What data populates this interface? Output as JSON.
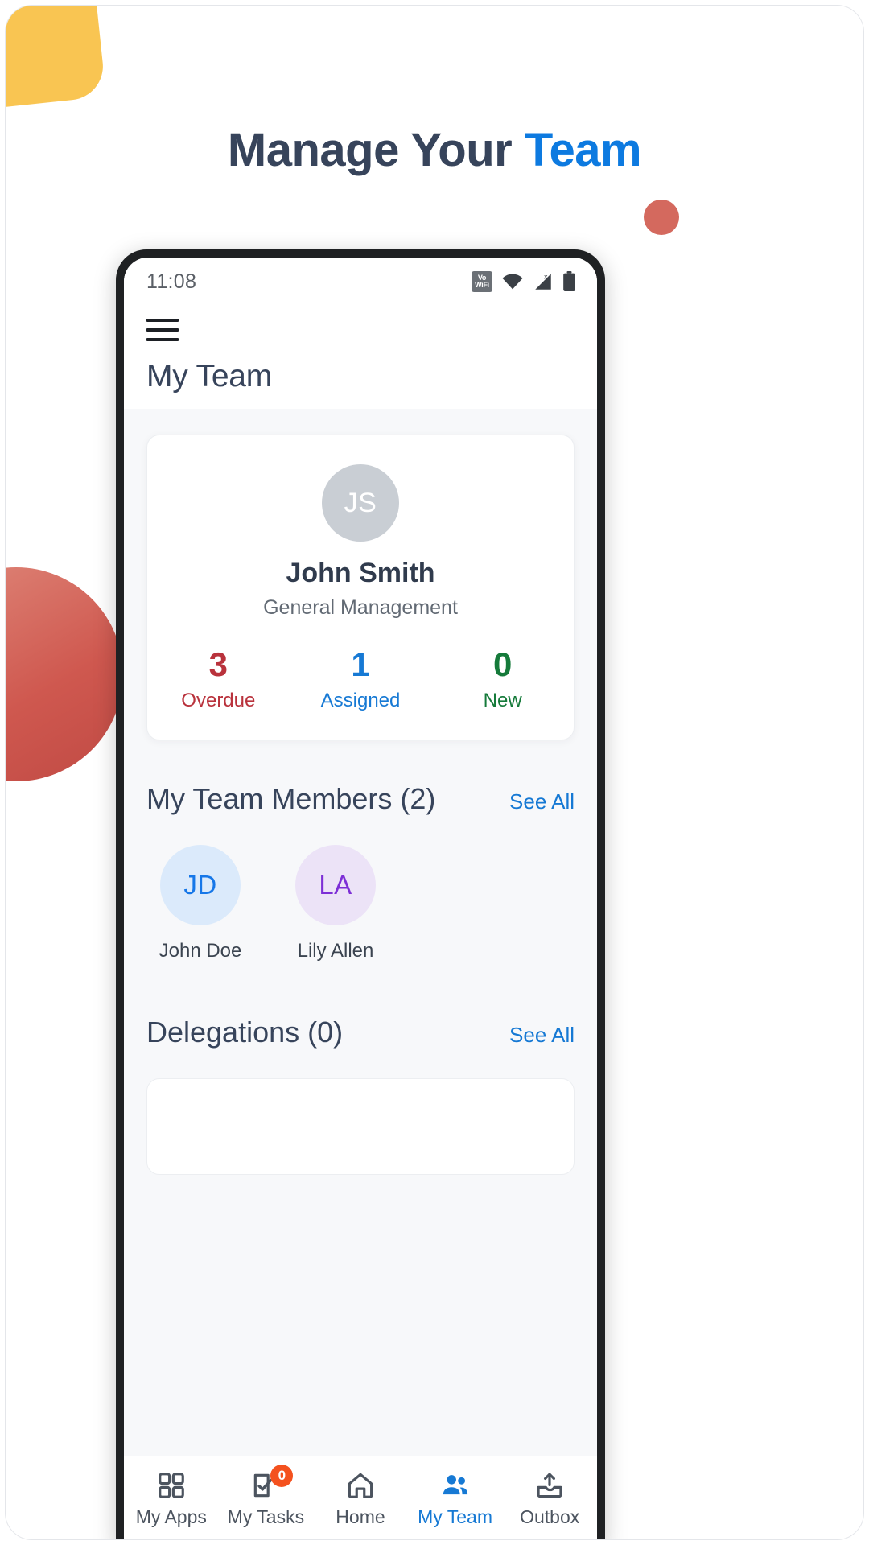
{
  "headline": {
    "text_primary": "Manage Your ",
    "text_accent": "Team"
  },
  "colors": {
    "accent_blue": "#0d7ae0",
    "link_blue": "#1679d4",
    "overdue_red": "#b9323c",
    "assigned_blue": "#1679d4",
    "new_green": "#157a3a",
    "badge_orange": "#f4511e",
    "yellow_blob": "#f9c552",
    "red_blob": "#cf584f"
  },
  "statusbar": {
    "time": "11:08",
    "icons": [
      "volte-wifi-icon",
      "wifi-icon",
      "signal-icon",
      "battery-icon"
    ],
    "volte_line1": "Vo",
    "volte_line2": "WiFi"
  },
  "appbar": {
    "menu_icon": "hamburger-menu-icon",
    "title": "My Team"
  },
  "profile": {
    "avatar_initials": "JS",
    "name": "John Smith",
    "role": "General Management",
    "stats": [
      {
        "value": "3",
        "label": "Overdue",
        "color": "#b9323c"
      },
      {
        "value": "1",
        "label": "Assigned",
        "color": "#1679d4"
      },
      {
        "value": "0",
        "label": "New",
        "color": "#157a3a"
      }
    ]
  },
  "team_members_section": {
    "title": "My Team Members (2)",
    "see_all": "See All",
    "members": [
      {
        "initials": "JD",
        "name": "John Doe",
        "bg": "#dbeafb",
        "fg": "#1677e8"
      },
      {
        "initials": "LA",
        "name": "Lily Allen",
        "bg": "#ece3f7",
        "fg": "#7d2fd6"
      }
    ]
  },
  "delegations_section": {
    "title": "Delegations (0)",
    "see_all": "See All"
  },
  "bottom_nav": {
    "items": [
      {
        "label": "My Apps",
        "icon": "grid-apps-icon",
        "active": false,
        "badge": null
      },
      {
        "label": "My Tasks",
        "icon": "checklist-icon",
        "active": false,
        "badge": "0"
      },
      {
        "label": "Home",
        "icon": "home-icon",
        "active": false,
        "badge": null
      },
      {
        "label": "My Team",
        "icon": "people-icon",
        "active": true,
        "badge": null
      },
      {
        "label": "Outbox",
        "icon": "outbox-upload-icon",
        "active": false,
        "badge": null
      }
    ]
  }
}
